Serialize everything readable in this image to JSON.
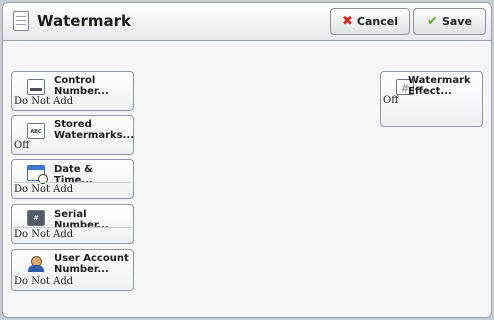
{
  "header": {
    "title": "Watermark",
    "cancel_label": "Cancel",
    "save_label": "Save"
  },
  "features": [
    {
      "label_lines": [
        "Control",
        "Number..."
      ],
      "value": "Do Not Add",
      "icon": "control-number-icon"
    },
    {
      "label_lines": [
        "Stored",
        "Watermarks..."
      ],
      "value": "Off",
      "icon": "stored-watermarks-icon",
      "icon_text": "ABC"
    },
    {
      "label_lines": [
        "Date & Time..."
      ],
      "value": "Do Not Add",
      "icon": "date-time-icon"
    },
    {
      "label_lines": [
        "Serial Number..."
      ],
      "value": "Do Not Add",
      "icon": "serial-number-icon",
      "icon_text": "#"
    },
    {
      "label_lines": [
        "User Account",
        "Number..."
      ],
      "value": "Do Not Add",
      "icon": "user-account-icon"
    }
  ],
  "watermark_effect": {
    "label_lines": [
      "Watermark",
      "Effect..."
    ],
    "value": "Off",
    "icon": "watermark-effect-icon",
    "icon_text": "#"
  },
  "colors": {
    "cancel_icon": "#d3261a",
    "save_icon": "#5bab2a",
    "background": "#f6f6f8"
  }
}
